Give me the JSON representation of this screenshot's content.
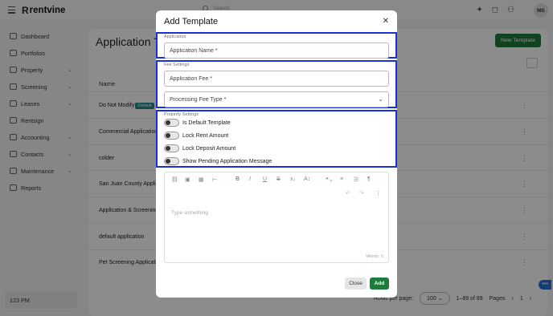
{
  "app": {
    "name": "rentvine",
    "logo_mark": "R",
    "search_placeholder": "Search",
    "user_initials": "MS"
  },
  "sidebar": {
    "items": [
      {
        "label": "Dashboard",
        "icon": "grid-icon",
        "chevron": false
      },
      {
        "label": "Portfolios",
        "icon": "folder-icon",
        "chevron": false
      },
      {
        "label": "Property",
        "icon": "building-icon",
        "chevron": true
      },
      {
        "label": "Screening",
        "icon": "screening-icon",
        "chevron": true
      },
      {
        "label": "Leases",
        "icon": "document-icon",
        "chevron": true
      },
      {
        "label": "Rentsign",
        "icon": "signature-icon",
        "chevron": false
      },
      {
        "label": "Accounting",
        "icon": "dollar-icon",
        "chevron": true
      },
      {
        "label": "Contacts",
        "icon": "contacts-icon",
        "chevron": true
      },
      {
        "label": "Maintenance",
        "icon": "wrench-icon",
        "chevron": true
      },
      {
        "label": "Reports",
        "icon": "reports-icon",
        "chevron": false
      }
    ],
    "time": "123 PM"
  },
  "main": {
    "title": "Application T",
    "new_button": "New Template",
    "column_header": "Name",
    "rows": [
      {
        "name": "Do Not Modify",
        "badge": "Default"
      },
      {
        "name": "Commercial Application",
        "badge": ""
      },
      {
        "name": "colder",
        "badge": ""
      },
      {
        "name": "San Juan County Applica",
        "badge": ""
      },
      {
        "name": "Application & Screening",
        "badge": ""
      },
      {
        "name": "default application",
        "badge": ""
      },
      {
        "name": "Pet Screening Applicatio",
        "badge": ""
      }
    ],
    "pagination": {
      "per_page_label": "Rows per page:",
      "per_page_value": "100",
      "range": "1–89 of 89",
      "pages_label": "Pages",
      "current_page": "1"
    }
  },
  "modal": {
    "title": "Add Template",
    "sections": {
      "application": {
        "label": "Application",
        "name_placeholder": "Application Name *"
      },
      "fee": {
        "label": "Fee Settings",
        "fee_placeholder": "Application Fee *",
        "fee_type_placeholder": "Processing Fee Type *"
      },
      "property": {
        "label": "Property Settings",
        "toggles": [
          {
            "label": "Is Default Template",
            "on": false
          },
          {
            "label": "Lock Rent Amount",
            "on": false
          },
          {
            "label": "Lock Deposit Amount",
            "on": false
          },
          {
            "label": "Show Pending Application Message",
            "on": false
          }
        ]
      }
    },
    "editor": {
      "placeholder": "Type something",
      "words": "Words: 0"
    },
    "buttons": {
      "close": "Close",
      "add": "Add"
    }
  },
  "colors": {
    "accent_green": "#1f7a3d",
    "highlight_blue": "#1a2fd6",
    "default_badge": "#1c8a8a"
  }
}
